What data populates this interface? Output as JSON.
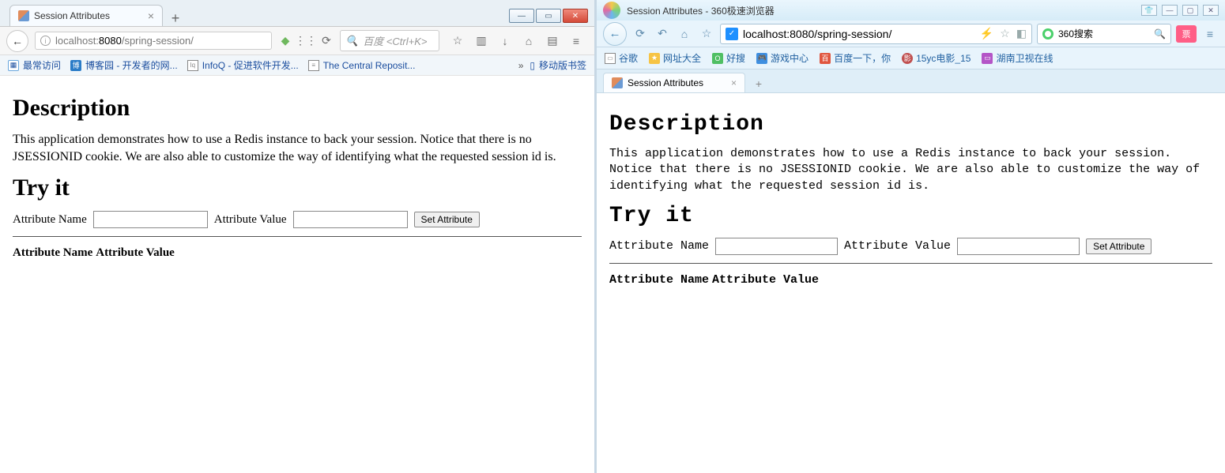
{
  "firefox": {
    "tab_title": "Session Attributes",
    "url_host": "localhost:",
    "url_port": "8080",
    "url_path": "/spring-session/",
    "search_placeholder": "百度 <Ctrl+K>",
    "bookmarks": {
      "most": "最常访问",
      "cnblogs": "博客园 - 开发者的网...",
      "infoq": "InfoQ - 促进软件开发...",
      "central": "The Central Reposit...",
      "mobile": "移动版书签"
    },
    "winbtn_min": "—",
    "winbtn_max": "▭",
    "winbtn_close": "✕"
  },
  "b360": {
    "title": "Session Attributes - 360极速浏览器",
    "url": "localhost:8080/spring-session/",
    "search_text": "360搜索",
    "pink": "票",
    "bookmarks": {
      "guge": "谷歌",
      "wzdq": "网址大全",
      "haosou": "好搜",
      "yxzx": "游戏中心",
      "baidu": "百度一下，你",
      "yc": "15yc电影_15",
      "hunan": "湖南卫视在线"
    },
    "tab_title": "Session Attributes"
  },
  "page": {
    "h_desc": "Description",
    "desc": "This application demonstrates how to use a Redis instance to back your session. Notice that there is no JSESSIONID cookie. We are also able to customize the way of identifying what the requested session id is.",
    "h_try": "Try it",
    "label_name": "Attribute Name",
    "label_value": "Attribute Value",
    "btn_set": "Set Attribute",
    "th_name": "Attribute Name",
    "th_value": "Attribute Value"
  }
}
